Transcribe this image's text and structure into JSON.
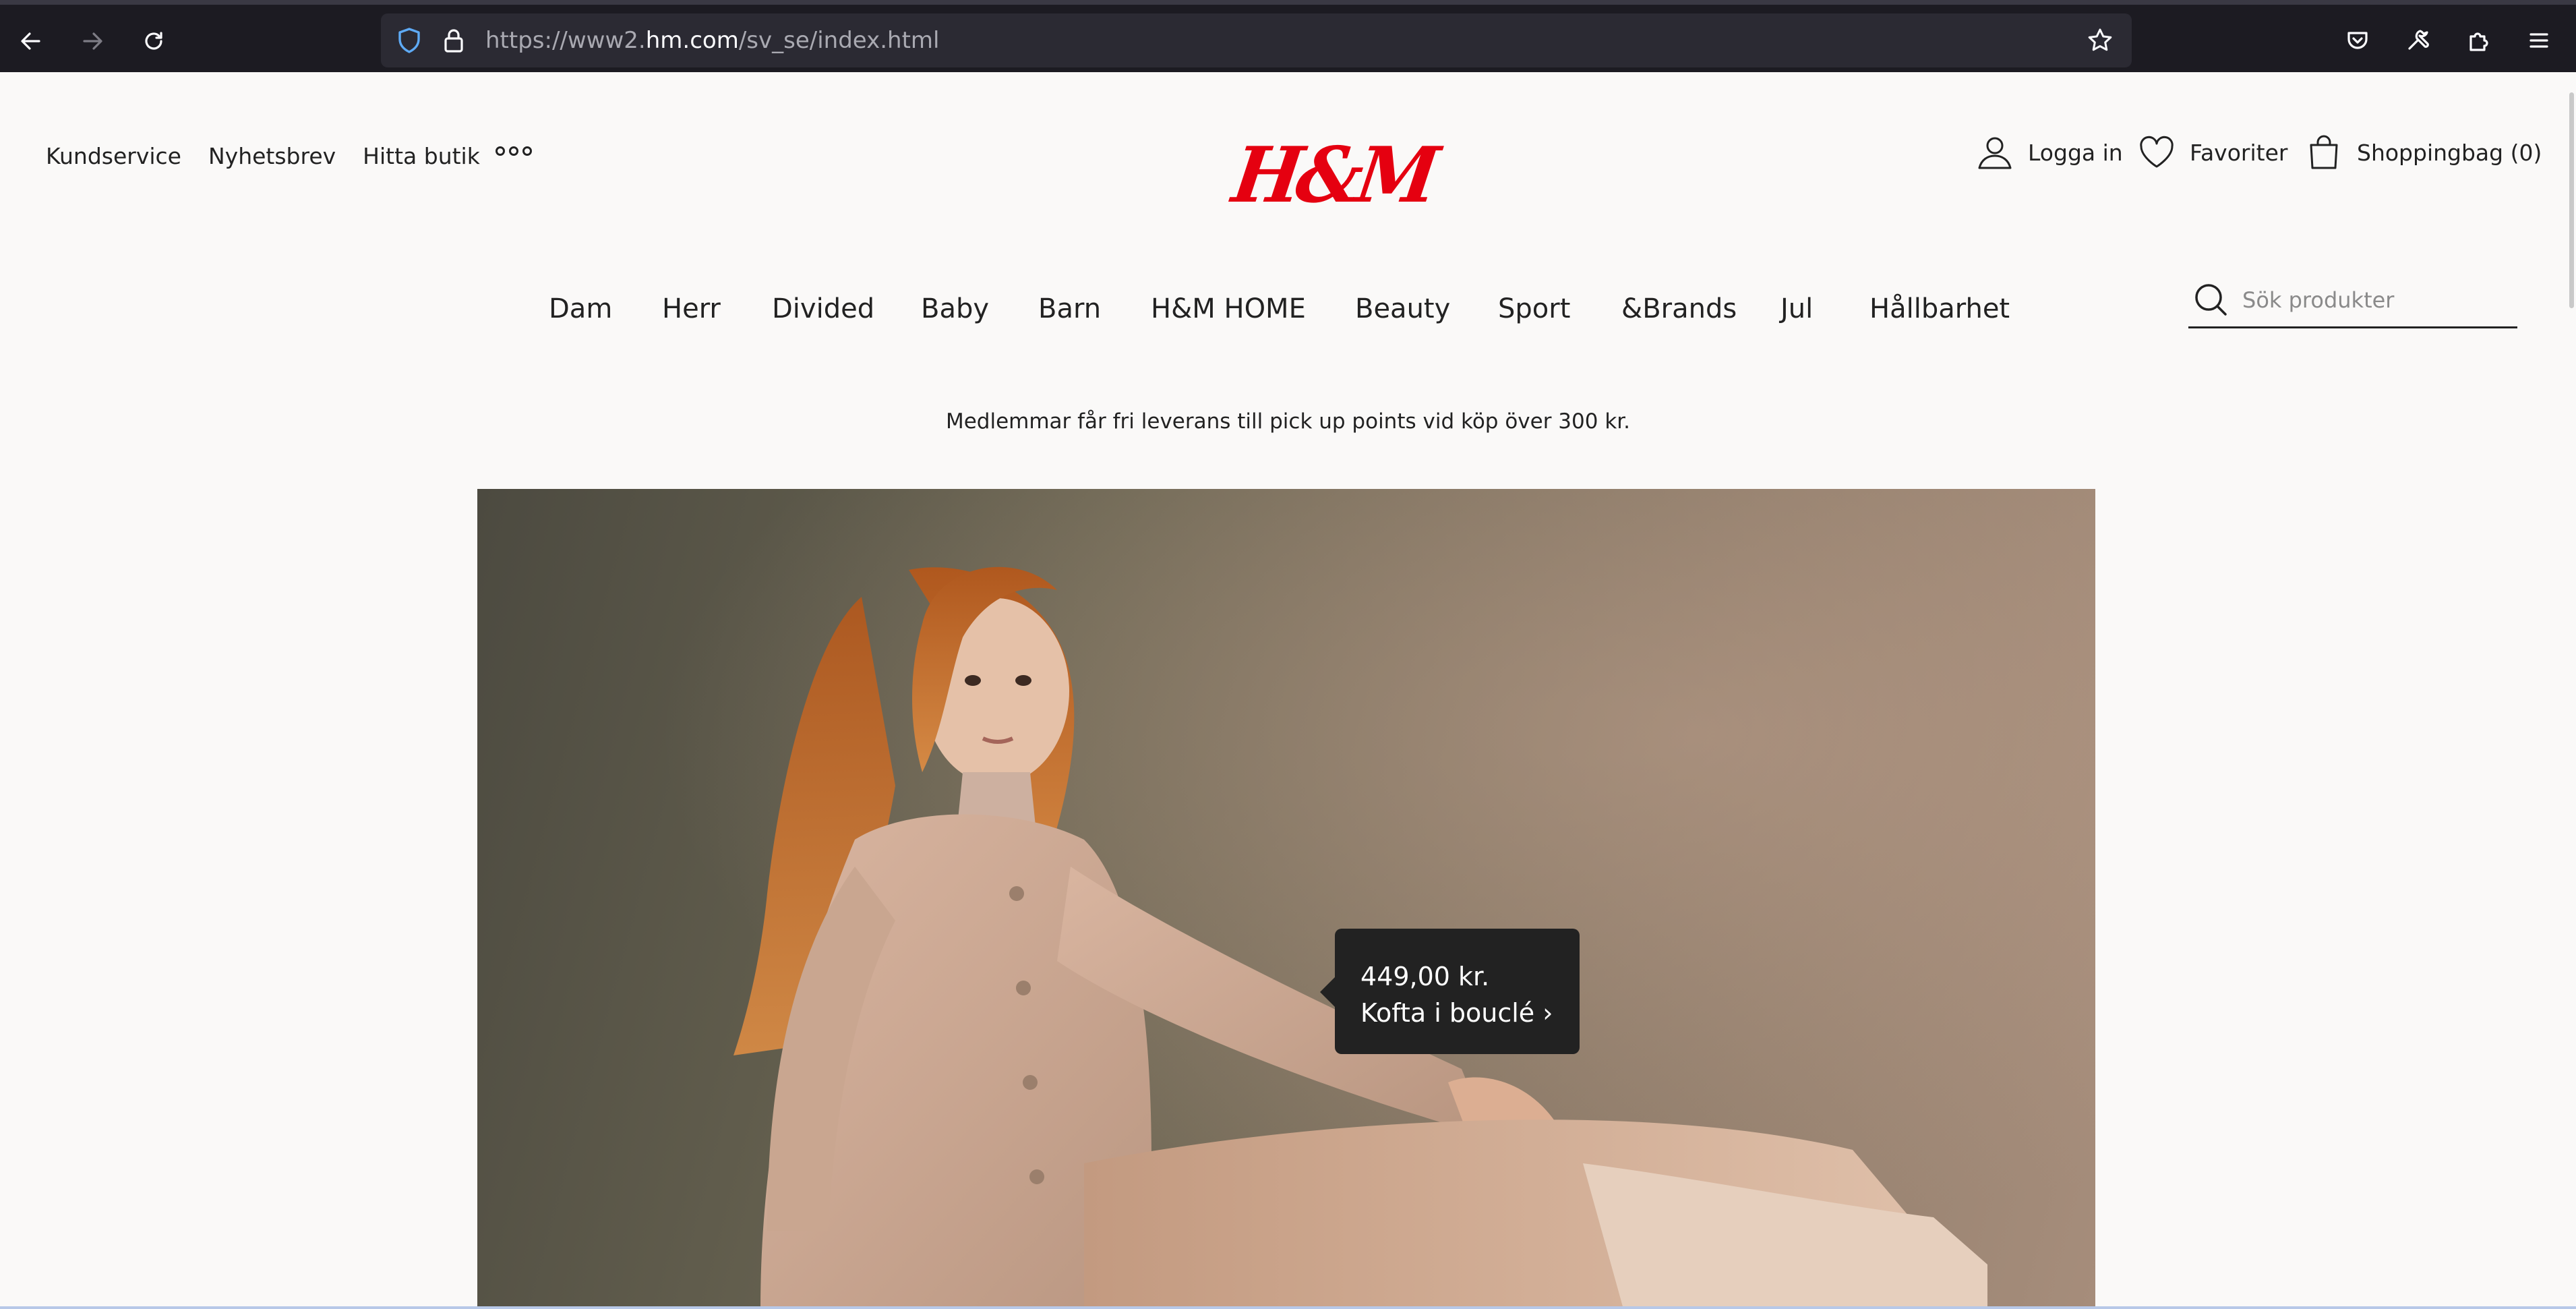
{
  "browser": {
    "url_prefix": "https://www2.",
    "url_domain": "hm.com",
    "url_path": "/sv_se/index.html",
    "icons": [
      "back-icon",
      "forward-icon",
      "reload-icon",
      "shield-icon",
      "lock-icon",
      "bookmark-star-icon",
      "pocket-icon",
      "wrench-icon",
      "extensions-icon",
      "menu-icon"
    ]
  },
  "header": {
    "util_links": [
      "Kundservice",
      "Nyhetsbrev",
      "Hitta butik"
    ],
    "logo": "H&M",
    "account": {
      "login": "Logga in",
      "favorites": "Favoriter",
      "bag": "Shoppingbag (0)"
    }
  },
  "nav": {
    "items": [
      "Dam",
      "Herr",
      "Divided",
      "Baby",
      "Barn",
      "H&M HOME",
      "Beauty",
      "Sport",
      "&Brands",
      "Jul",
      "Hållbarhet"
    ]
  },
  "search": {
    "placeholder": "Sök produkter"
  },
  "promo": {
    "text": "Medlemmar får fri leverans till pick up points vid köp över 300 kr."
  },
  "hero": {
    "product_tag": {
      "price": "449,00 kr.",
      "name": "Kofta i bouclé ›"
    }
  },
  "colors": {
    "brand_red": "#e50010",
    "chrome_bg": "#1c1b22",
    "page_bg": "#faf9f8",
    "tag_bg": "#222222"
  }
}
